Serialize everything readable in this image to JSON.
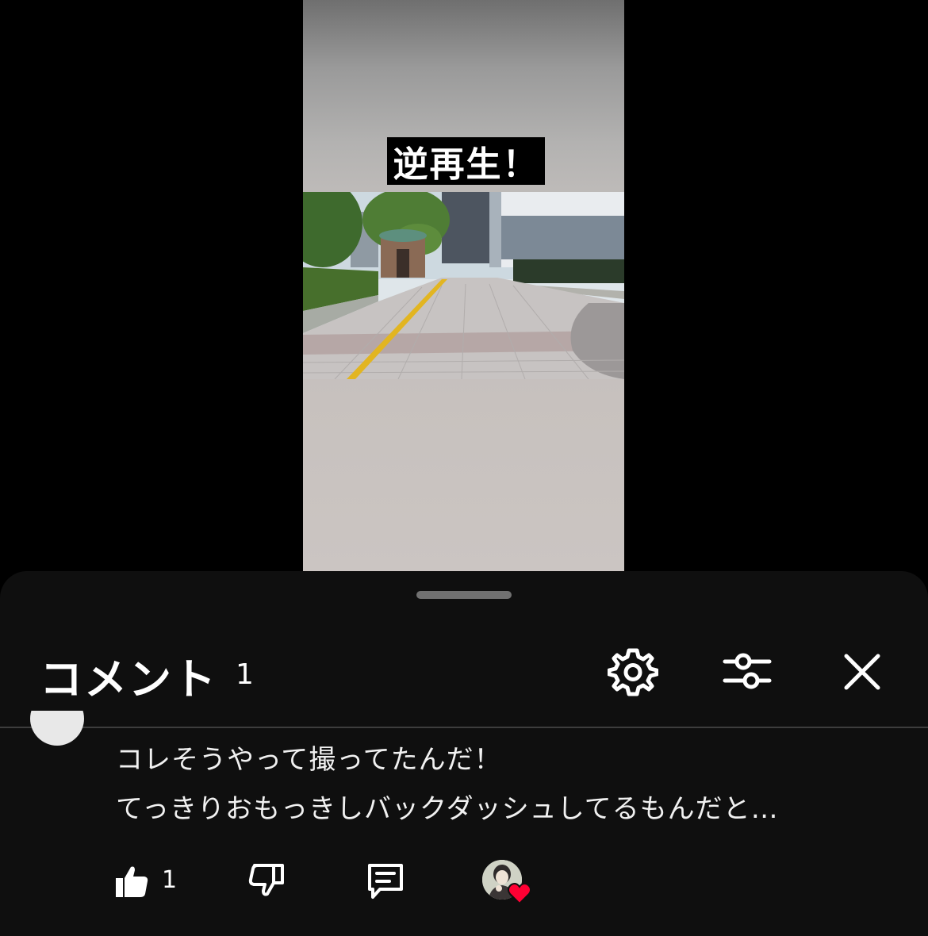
{
  "video": {
    "caption": "逆再生！"
  },
  "comments_panel": {
    "title": "コメント",
    "count": "1",
    "icons": {
      "settings": "gear-icon",
      "filter": "sliders-icon",
      "close": "close-icon"
    }
  },
  "comment": {
    "line1": "コレそうやって撮ってたんだ！",
    "line2": "てっきりおもっきしバックダッシュしてるもんだと…",
    "likes": "1",
    "actions": {
      "like": "thumbs-up-icon",
      "dislike": "thumbs-down-icon",
      "reply": "reply-icon",
      "creator_heart": "heart-icon"
    }
  },
  "colors": {
    "sheet_background": "#0f0f0f",
    "heart": "#ff0033"
  }
}
